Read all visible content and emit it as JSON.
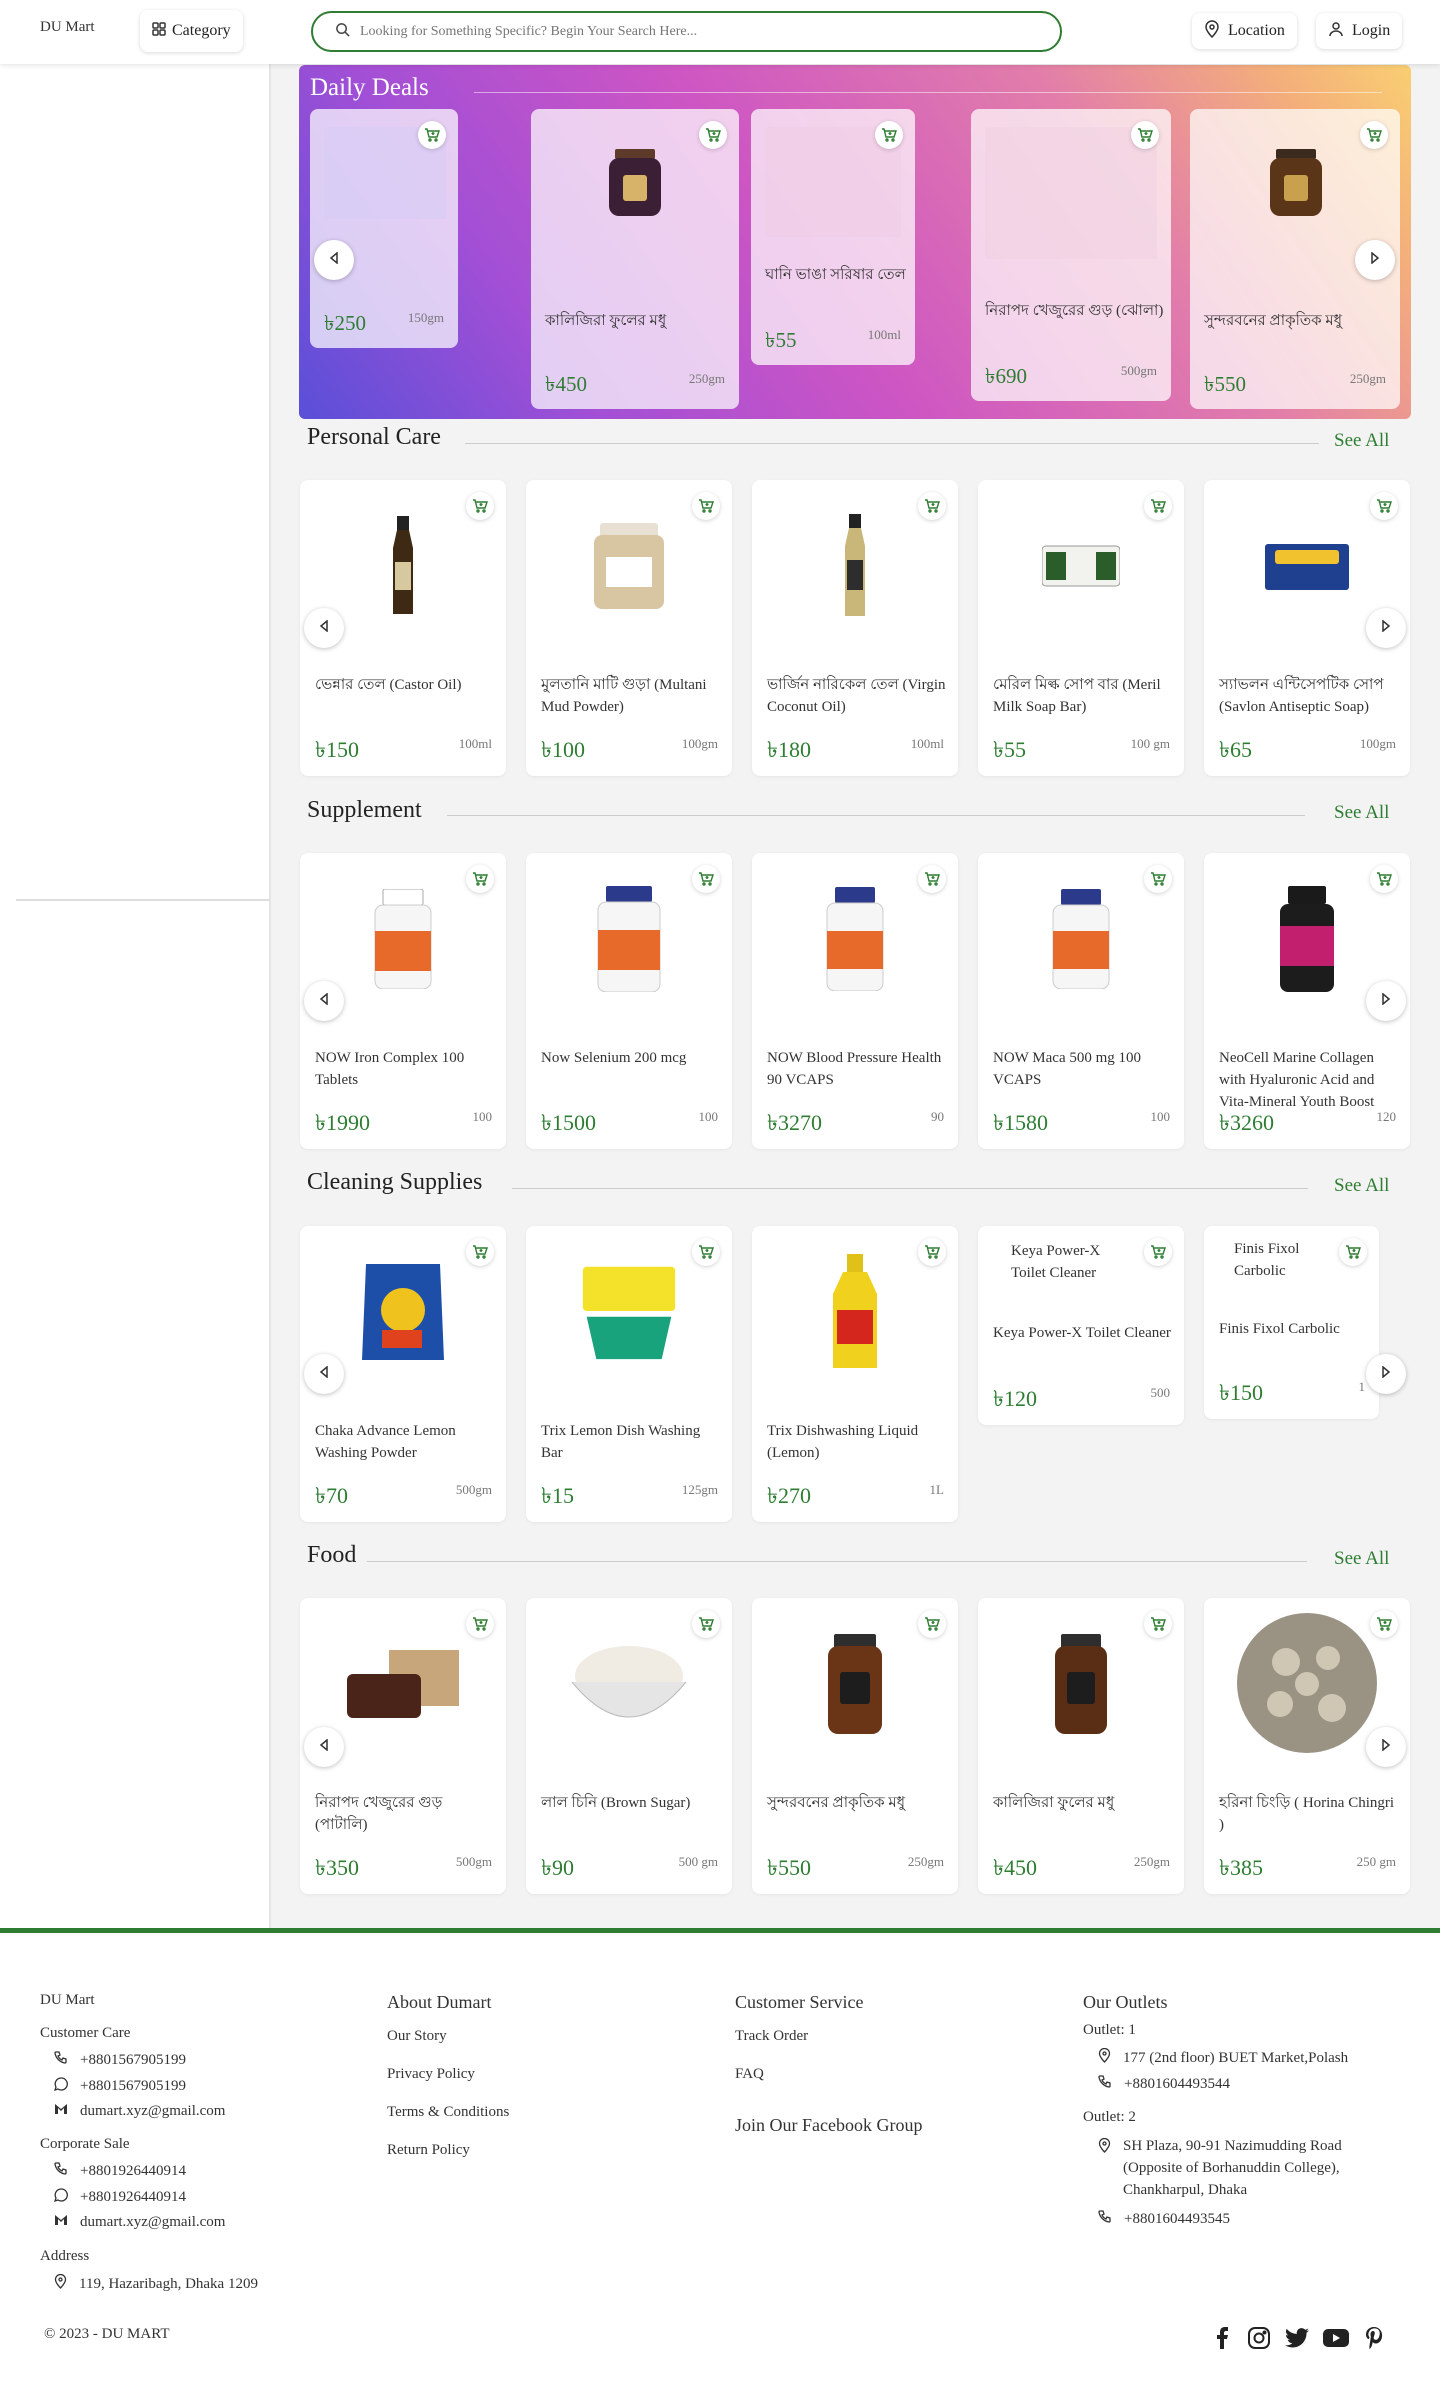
{
  "header": {
    "logo_alt": "DU Mart",
    "category": "Category",
    "search_placeholder": "Looking for Something Specific? Begin Your Search Here...",
    "location": "Location",
    "login": "Login"
  },
  "daily_deals": {
    "title": "Daily Deals",
    "items": [
      {
        "name": "",
        "price": "৳250",
        "qty": "150gm"
      },
      {
        "name": "কালিজিরা ফুলের মধু",
        "price": "৳450",
        "qty": "250gm"
      },
      {
        "name": "ঘানি ভাঙা সরিষার তেল",
        "price": "৳55",
        "qty": "100ml"
      },
      {
        "name": "নিরাপদ খেজুরের গুড় (ঝোলা)",
        "price": "৳690",
        "qty": "500gm"
      },
      {
        "name": "সুন্দরবনের প্রাকৃতিক মধু",
        "price": "৳550",
        "qty": "250gm"
      }
    ]
  },
  "see_all": "See All",
  "sections": [
    {
      "title": "Personal Care",
      "products": [
        {
          "name": "ভেন্নার তেল (Castor Oil)",
          "price": "৳150",
          "qty": "100ml"
        },
        {
          "name": "মুলতানি মাটি গুড়া (Multani Mud Powder)",
          "price": "৳100",
          "qty": "100gm"
        },
        {
          "name": "ভার্জিন নারিকেল তেল (Virgin Coconut Oil)",
          "price": "৳180",
          "qty": "100ml"
        },
        {
          "name": "মেরিল মিল্ক সোপ বার (Meril Milk Soap Bar)",
          "price": "৳55",
          "qty": "100 gm"
        },
        {
          "name": "স্যাভলন এন্টিসেপটিক সোপ (Savlon Antiseptic Soap)",
          "price": "৳65",
          "qty": "100gm"
        }
      ]
    },
    {
      "title": "Supplement",
      "products": [
        {
          "name": "NOW Iron Complex 100 Tablets",
          "price": "৳1990",
          "qty": "100"
        },
        {
          "name": "Now Selenium 200 mcg",
          "price": "৳1500",
          "qty": "100"
        },
        {
          "name": "NOW Blood Pressure Health 90 VCAPS",
          "price": "৳3270",
          "qty": "90"
        },
        {
          "name": "NOW Maca 500 mg 100 VCAPS",
          "price": "৳1580",
          "qty": "100"
        },
        {
          "name": "NeoCell Marine Collagen with Hyaluronic Acid and Vita-Mineral Youth Boost",
          "price": "৳3260",
          "qty": "120"
        }
      ]
    },
    {
      "title": "Cleaning Supplies",
      "products": [
        {
          "name": "Chaka Advance Lemon Washing Powder",
          "price": "৳70",
          "qty": "500gm"
        },
        {
          "name": "Trix Lemon Dish Washing Bar",
          "price": "৳15",
          "qty": "125gm"
        },
        {
          "name": "Trix Dishwashing Liquid (Lemon)",
          "price": "৳270",
          "qty": "1L"
        },
        {
          "name": "Keya Power-X Toilet Cleaner",
          "price": "৳120",
          "qty": "500",
          "alt": "Keya Power-X Toilet Cleaner"
        },
        {
          "name": "Finis Fixol Carbolic",
          "price": "৳150",
          "qty": "1",
          "alt": "Finis Fixol Carbolic"
        }
      ]
    },
    {
      "title": "Food",
      "products": [
        {
          "name": "নিরাপদ খেজুরের গুড় (পাটালি)",
          "price": "৳350",
          "qty": "500gm"
        },
        {
          "name": "লাল চিনি (Brown Sugar)",
          "price": "৳90",
          "qty": "500 gm"
        },
        {
          "name": "সুন্দরবনের প্রাকৃতিক মধু",
          "price": "৳550",
          "qty": "250gm"
        },
        {
          "name": "কালিজিরা ফুলের মধু",
          "price": "৳450",
          "qty": "250gm"
        },
        {
          "name": "হরিনা চিংড়ি ( Horina Chingri )",
          "price": "৳385",
          "qty": "250 gm"
        }
      ]
    }
  ],
  "footer": {
    "logo_alt": "DU Mart",
    "customer_care": "Customer Care",
    "cc_phone": "+8801567905199",
    "cc_whatsapp": "+8801567905199",
    "cc_email": "dumart.xyz@gmail.com",
    "corporate_sale": "Corporate Sale",
    "cs_phone": "+8801926440914",
    "cs_whatsapp": "+8801926440914",
    "cs_email": "dumart.xyz@gmail.com",
    "address_label": "Address",
    "address": "119, Hazaribagh, Dhaka 1209",
    "about_title": "About Dumart",
    "about_links": [
      "Our Story",
      "Privacy Policy",
      "Terms & Conditions",
      "Return Policy"
    ],
    "service_title": "Customer Service",
    "service_links": [
      "Track Order",
      "FAQ"
    ],
    "facebook_group": "Join Our Facebook Group",
    "outlets_title": "Our Outlets",
    "outlet1_label": "Outlet: 1",
    "outlet1_address": "177 (2nd floor) BUET Market,Polash",
    "outlet1_phone": "+8801604493544",
    "outlet2_label": "Outlet: 2",
    "outlet2_address": "SH Plaza, 90-91 Nazimudding Road (Opposite of Borhanuddin College), Chankharpul, Dhaka",
    "outlet2_phone": "+8801604493545",
    "copyright": "© 2023 - DU MART"
  },
  "colors": {
    "accent": "#2e7d32",
    "price": "#2e7d32"
  }
}
